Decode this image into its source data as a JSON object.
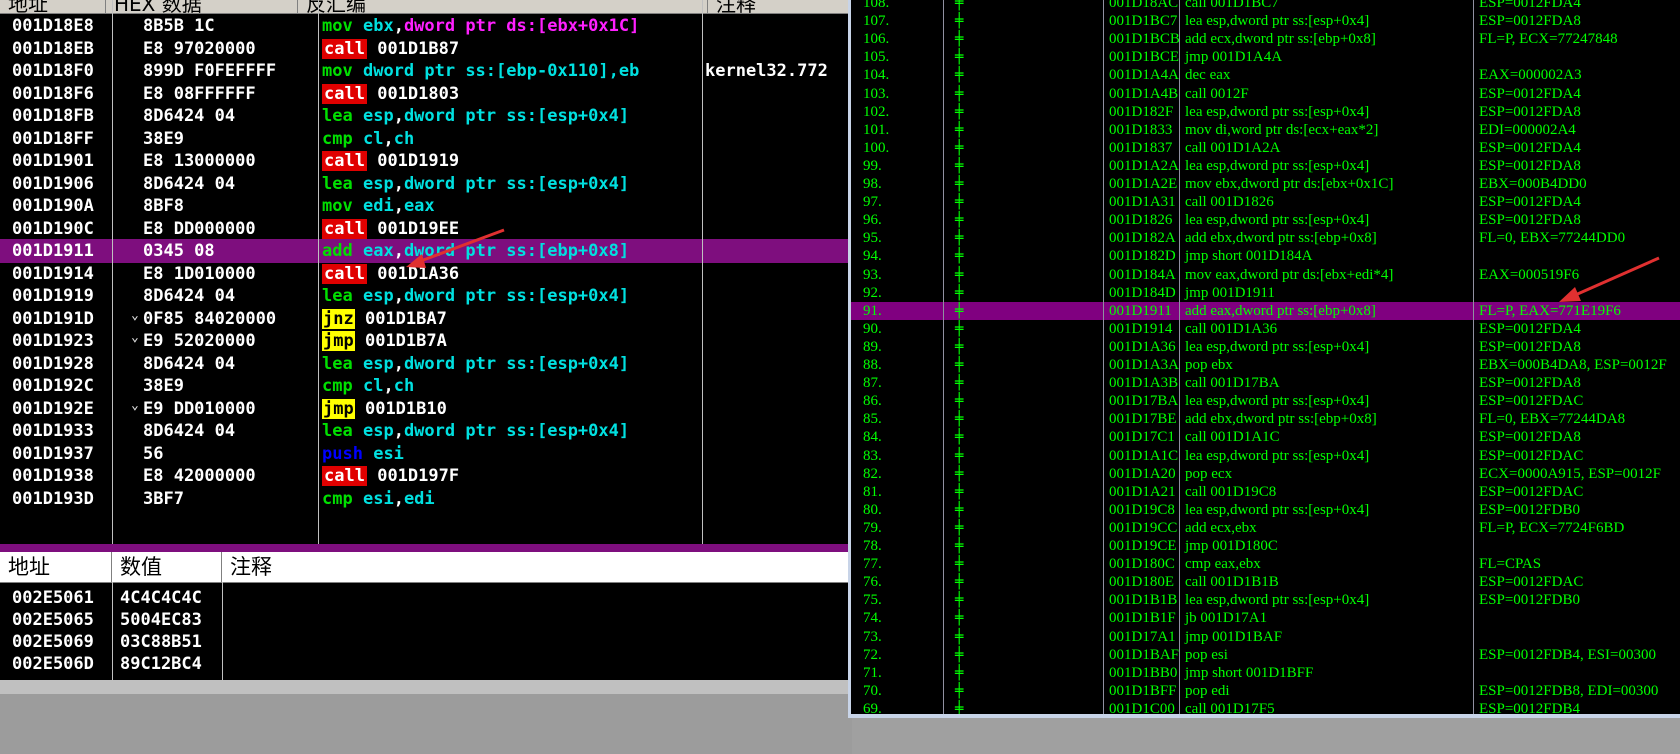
{
  "disasm": {
    "headers": [
      "地址",
      "HEX 数据",
      "反汇编",
      "注释"
    ],
    "rows": [
      {
        "addr": "001D18E8",
        "hex": "8B5B 1C",
        "m": "mov",
        "mc": "mov",
        "ops": [
          [
            "ebx",
            "reg"
          ],
          [
            ",",
            ""
          ],
          [
            "dword ptr ds:[ebx+0x1C]",
            "mag"
          ]
        ],
        "cmt": ""
      },
      {
        "addr": "001D18EB",
        "hex": "E8 97020000",
        "m": "call",
        "mc": "call",
        "ops": [
          [
            "001D1B87",
            "tgt"
          ]
        ],
        "cmt": ""
      },
      {
        "addr": "001D18F0",
        "hex": "899D F0FEFFFF",
        "m": "mov",
        "mc": "mov",
        "ops": [
          [
            "dword ptr ss:[ebp-0x110],eb",
            "reg"
          ]
        ],
        "cmt": "kernel32.772"
      },
      {
        "addr": "001D18F6",
        "hex": "E8 08FFFFFF",
        "m": "call",
        "mc": "call",
        "ops": [
          [
            "001D1803",
            "tgt"
          ]
        ],
        "cmt": ""
      },
      {
        "addr": "001D18FB",
        "hex": "8D6424 04",
        "m": "lea",
        "mc": "mov",
        "ops": [
          [
            "esp",
            "reg"
          ],
          [
            ",",
            ""
          ],
          [
            "dword ptr ss:[esp+0x4]",
            "reg"
          ]
        ],
        "cmt": ""
      },
      {
        "addr": "001D18FF",
        "hex": "38E9",
        "m": "cmp",
        "mc": "mov",
        "ops": [
          [
            "cl",
            "reg"
          ],
          [
            ",",
            ""
          ],
          [
            "ch",
            "reg"
          ]
        ],
        "cmt": ""
      },
      {
        "addr": "001D1901",
        "hex": "E8 13000000",
        "m": "call",
        "mc": "call",
        "ops": [
          [
            "001D1919",
            "tgt"
          ]
        ],
        "cmt": ""
      },
      {
        "addr": "001D1906",
        "hex": "8D6424 04",
        "m": "lea",
        "mc": "mov",
        "ops": [
          [
            "esp",
            "reg"
          ],
          [
            ",",
            ""
          ],
          [
            "dword ptr ss:[esp+0x4]",
            "reg"
          ]
        ],
        "cmt": ""
      },
      {
        "addr": "001D190A",
        "hex": "8BF8",
        "m": "mov",
        "mc": "mov",
        "ops": [
          [
            "edi",
            "reg"
          ],
          [
            ",",
            ""
          ],
          [
            "eax",
            "reg"
          ]
        ],
        "cmt": ""
      },
      {
        "addr": "001D190C",
        "hex": "E8 DD000000",
        "m": "call",
        "mc": "call",
        "ops": [
          [
            "001D19EE",
            "tgt"
          ]
        ],
        "cmt": ""
      },
      {
        "addr": "001D1911",
        "hex": "0345 08",
        "m": "add",
        "mc": "mov",
        "ops": [
          [
            "eax",
            "reg"
          ],
          [
            ",",
            ""
          ],
          [
            "dword ptr ss:[ebp+0x8]",
            "reg"
          ]
        ],
        "cmt": "",
        "sel": true
      },
      {
        "addr": "001D1914",
        "hex": "E8 1D010000",
        "m": "call",
        "mc": "call",
        "ops": [
          [
            "001D1A36",
            "tgt"
          ]
        ],
        "cmt": ""
      },
      {
        "addr": "001D1919",
        "hex": "8D6424 04",
        "m": "lea",
        "mc": "mov",
        "ops": [
          [
            "esp",
            "reg"
          ],
          [
            ",",
            ""
          ],
          [
            "dword ptr ss:[esp+0x4]",
            "reg"
          ]
        ],
        "cmt": ""
      },
      {
        "addr": "001D191D",
        "hex": "0F85 84020000",
        "m": "jnz",
        "mc": "jmp",
        "ops": [
          [
            "001D1BA7",
            "tgt"
          ]
        ],
        "cmt": "",
        "jm": "⌄"
      },
      {
        "addr": "001D1923",
        "hex": "E9 52020000",
        "m": "jmp",
        "mc": "jmp",
        "ops": [
          [
            "001D1B7A",
            "tgt"
          ]
        ],
        "cmt": "",
        "jm": "⌄"
      },
      {
        "addr": "001D1928",
        "hex": "8D6424 04",
        "m": "lea",
        "mc": "mov",
        "ops": [
          [
            "esp",
            "reg"
          ],
          [
            ",",
            ""
          ],
          [
            "dword ptr ss:[esp+0x4]",
            "reg"
          ]
        ],
        "cmt": ""
      },
      {
        "addr": "001D192C",
        "hex": "38E9",
        "m": "cmp",
        "mc": "mov",
        "ops": [
          [
            "cl",
            "reg"
          ],
          [
            ",",
            ""
          ],
          [
            "ch",
            "reg"
          ]
        ],
        "cmt": ""
      },
      {
        "addr": "001D192E",
        "hex": "E9 DD010000",
        "m": "jmp",
        "mc": "jmp",
        "ops": [
          [
            "001D1B10",
            "tgt"
          ]
        ],
        "cmt": "",
        "jm": "⌄"
      },
      {
        "addr": "001D1933",
        "hex": "8D6424 04",
        "m": "lea",
        "mc": "mov",
        "ops": [
          [
            "esp",
            "reg"
          ],
          [
            ",",
            ""
          ],
          [
            "dword ptr ss:[esp+0x4]",
            "reg"
          ]
        ],
        "cmt": ""
      },
      {
        "addr": "001D1937",
        "hex": "56",
        "m": "push",
        "mc": "push",
        "ops": [
          [
            "esi",
            "reg"
          ]
        ],
        "cmt": ""
      },
      {
        "addr": "001D1938",
        "hex": "E8 42000000",
        "m": "call",
        "mc": "call",
        "ops": [
          [
            "001D197F",
            "tgt"
          ]
        ],
        "cmt": ""
      },
      {
        "addr": "001D193D",
        "hex": "3BF7",
        "m": "cmp",
        "mc": "mov",
        "ops": [
          [
            "esi",
            "reg"
          ],
          [
            ",",
            ""
          ],
          [
            "edi",
            "reg"
          ]
        ],
        "cmt": ""
      }
    ]
  },
  "dump": {
    "headers": [
      "地址",
      "数值",
      "注释"
    ],
    "rows": [
      {
        "addr": "002E5061",
        "val": "4C4C4C4C"
      },
      {
        "addr": "002E5065",
        "val": "5004EC83"
      },
      {
        "addr": "002E5069",
        "val": "03C88B51"
      },
      {
        "addr": "002E506D",
        "val": "89C12BC4"
      }
    ]
  },
  "trace": {
    "rows": [
      {
        "n": "108.",
        "a": "001D18AC",
        "i": "call 001D1BC7",
        "r": "ESP=0012FDA4"
      },
      {
        "n": "107.",
        "a": "001D1BC7",
        "i": "lea esp,dword ptr ss:[esp+0x4]",
        "r": "ESP=0012FDA8"
      },
      {
        "n": "106.",
        "a": "001D1BCB",
        "i": "add ecx,dword ptr ss:[ebp+0x8]",
        "r": "FL=P, ECX=77247848"
      },
      {
        "n": "105.",
        "a": "001D1BCE",
        "i": "jmp 001D1A4A",
        "r": ""
      },
      {
        "n": "104.",
        "a": "001D1A4A",
        "i": "dec eax",
        "r": "EAX=000002A3"
      },
      {
        "n": "103.",
        "a": "001D1A4B",
        "i": "call 0012F",
        "r": "ESP=0012FDA4"
      },
      {
        "n": "102.",
        "a": "001D182F",
        "i": "lea esp,dword ptr ss:[esp+0x4]",
        "r": "ESP=0012FDA8"
      },
      {
        "n": "101.",
        "a": "001D1833",
        "i": "mov di,word ptr ds:[ecx+eax*2]",
        "r": "EDI=000002A4"
      },
      {
        "n": "100.",
        "a": "001D1837",
        "i": "call 001D1A2A",
        "r": "ESP=0012FDA4"
      },
      {
        "n": "99.",
        "a": "001D1A2A",
        "i": "lea esp,dword ptr ss:[esp+0x4]",
        "r": "ESP=0012FDA8"
      },
      {
        "n": "98.",
        "a": "001D1A2E",
        "i": "mov ebx,dword ptr ds:[ebx+0x1C]",
        "r": "EBX=000B4DD0"
      },
      {
        "n": "97.",
        "a": "001D1A31",
        "i": "call 001D1826",
        "r": "ESP=0012FDA4"
      },
      {
        "n": "96.",
        "a": "001D1826",
        "i": "lea esp,dword ptr ss:[esp+0x4]",
        "r": "ESP=0012FDA8"
      },
      {
        "n": "95.",
        "a": "001D182A",
        "i": "add ebx,dword ptr ss:[ebp+0x8]",
        "r": "FL=0, EBX=77244DD0"
      },
      {
        "n": "94.",
        "a": "001D182D",
        "i": "jmp short 001D184A",
        "r": ""
      },
      {
        "n": "93.",
        "a": "001D184A",
        "i": "mov eax,dword ptr ds:[ebx+edi*4]",
        "r": "EAX=000519F6"
      },
      {
        "n": "92.",
        "a": "001D184D",
        "i": "jmp 001D1911",
        "r": ""
      },
      {
        "n": "91.",
        "a": "001D1911",
        "i": "add eax,dword ptr ss:[ebp+0x8]",
        "r": "FL=P, EAX=771E19F6",
        "sel": true
      },
      {
        "n": "90.",
        "a": "001D1914",
        "i": "call 001D1A36",
        "r": "ESP=0012FDA4"
      },
      {
        "n": "89.",
        "a": "001D1A36",
        "i": "lea esp,dword ptr ss:[esp+0x4]",
        "r": "ESP=0012FDA8"
      },
      {
        "n": "88.",
        "a": "001D1A3A",
        "i": "pop ebx",
        "r": "EBX=000B4DA8, ESP=0012F"
      },
      {
        "n": "87.",
        "a": "001D1A3B",
        "i": "call 001D17BA",
        "r": "ESP=0012FDA8"
      },
      {
        "n": "86.",
        "a": "001D17BA",
        "i": "lea esp,dword ptr ss:[esp+0x4]",
        "r": "ESP=0012FDAC"
      },
      {
        "n": "85.",
        "a": "001D17BE",
        "i": "add ebx,dword ptr ss:[ebp+0x8]",
        "r": "FL=0, EBX=77244DA8"
      },
      {
        "n": "84.",
        "a": "001D17C1",
        "i": "call 001D1A1C",
        "r": "ESP=0012FDA8"
      },
      {
        "n": "83.",
        "a": "001D1A1C",
        "i": "lea esp,dword ptr ss:[esp+0x4]",
        "r": "ESP=0012FDAC"
      },
      {
        "n": "82.",
        "a": "001D1A20",
        "i": "pop ecx",
        "r": "ECX=0000A915, ESP=0012F"
      },
      {
        "n": "81.",
        "a": "001D1A21",
        "i": "call 001D19C8",
        "r": "ESP=0012FDAC"
      },
      {
        "n": "80.",
        "a": "001D19C8",
        "i": "lea esp,dword ptr ss:[esp+0x4]",
        "r": "ESP=0012FDB0"
      },
      {
        "n": "79.",
        "a": "001D19CC",
        "i": "add ecx,ebx",
        "r": "FL=P, ECX=7724F6BD"
      },
      {
        "n": "78.",
        "a": "001D19CE",
        "i": "jmp 001D180C",
        "r": ""
      },
      {
        "n": "77.",
        "a": "001D180C",
        "i": "cmp eax,ebx",
        "r": "FL=CPAS"
      },
      {
        "n": "76.",
        "a": "001D180E",
        "i": "call 001D1B1B",
        "r": "ESP=0012FDAC"
      },
      {
        "n": "75.",
        "a": "001D1B1B",
        "i": "lea esp,dword ptr ss:[esp+0x4]",
        "r": "ESP=0012FDB0"
      },
      {
        "n": "74.",
        "a": "001D1B1F",
        "i": "jb 001D17A1",
        "r": ""
      },
      {
        "n": "73.",
        "a": "001D17A1",
        "i": "jmp 001D1BAF",
        "r": ""
      },
      {
        "n": "72.",
        "a": "001D1BAF",
        "i": "pop esi",
        "r": "ESP=0012FDB4, ESI=00300"
      },
      {
        "n": "71.",
        "a": "001D1BB0",
        "i": "jmp short 001D1BFF",
        "r": ""
      },
      {
        "n": "70.",
        "a": "001D1BFF",
        "i": "pop edi",
        "r": "ESP=0012FDB8, EDI=00300"
      },
      {
        "n": "69.",
        "a": "001D1C00",
        "i": "call 001D17F5",
        "r": "ESP=0012FDB4"
      }
    ],
    "tick": "╪"
  },
  "colors": {
    "select": "#800080",
    "green": "#00e000",
    "call_bg": "#e00000",
    "jmp_bg": "#ffff00",
    "arrow": "#e03030"
  }
}
